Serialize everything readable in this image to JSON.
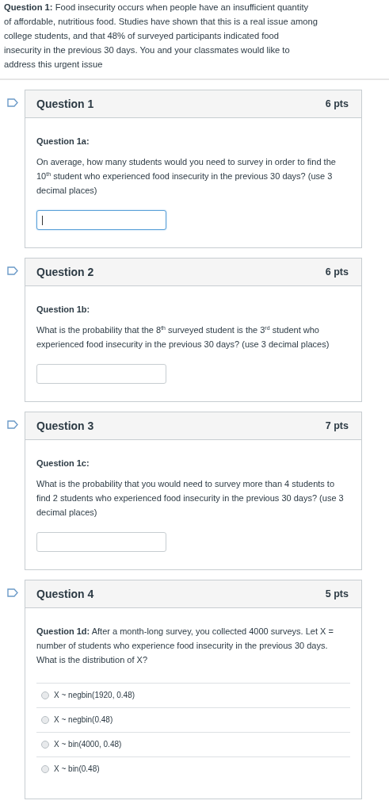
{
  "intro": "**Question 1:** Food insecurity occurs when people have an insufficient quantity of affordable, nutritious food.  Studies have shown that this is a real issue among college students, and that 48% of surveyed participants indicated food insecurity in the previous 30 days. You and your classmates would like to address this urgent issue",
  "questions": [
    {
      "title": "Question 1",
      "points": "6 pts",
      "kind": "text",
      "label": "Question 1a:",
      "prompt": "On average, how many students would you need to survey in order to find the 10$^{th}$ student who experienced food insecurity in the previous 30 days? (use 3 decimal places)",
      "focused": true
    },
    {
      "title": "Question 2",
      "points": "6 pts",
      "kind": "text",
      "label": "Question 1b:",
      "prompt": "What is the probability that the 8$^{th}$ surveyed student is the 3$^{rd}$ student who experienced food insecurity in the previous 30 days? (use 3 decimal places)",
      "focused": false
    },
    {
      "title": "Question 3",
      "points": "7 pts",
      "kind": "text",
      "label": "Question 1c:",
      "prompt": "What is the probability that you would need to survey more than 4 students to find 2 students who experienced food insecurity in the previous 30 days? (use 3 decimal places)",
      "focused": false
    },
    {
      "title": "Question 4",
      "points": "5 pts",
      "kind": "choice",
      "prompt": "**Question 1d:** After a month-long survey, you collected 4000 surveys.  Let X = number of students who experience food insecurity in the previous 30 days.  What is the distribution of X?",
      "choices": [
        {
          "label": "X ~ negbin(1920, 0.48)",
          "selected": false
        },
        {
          "label": "X ~ negbin(0.48)",
          "selected": false
        },
        {
          "label": "X ~ bin(4000, 0.48)",
          "selected": false
        },
        {
          "label": "X ~ bin(0.48)",
          "selected": false
        }
      ]
    }
  ]
}
